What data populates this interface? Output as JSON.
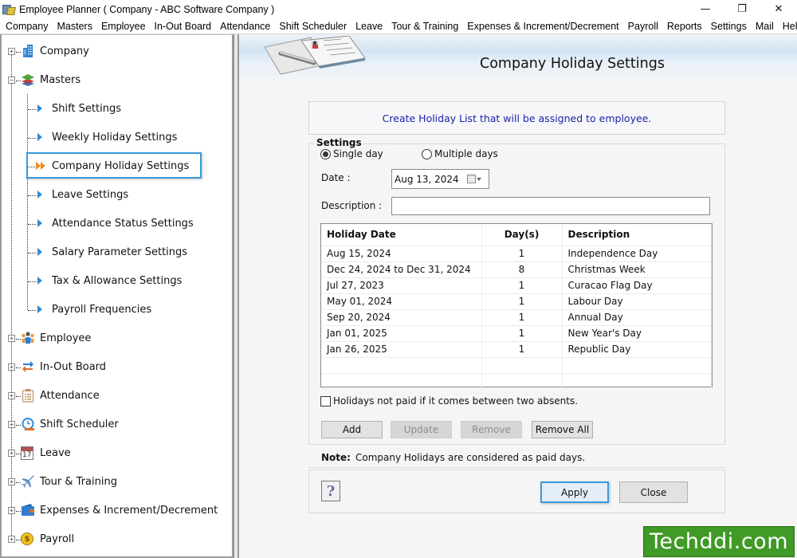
{
  "window": {
    "title": "Employee Planner ( Company - ABC Software Company )",
    "controls": {
      "minimize": "—",
      "restore": "❐",
      "close": "✕"
    }
  },
  "menu": [
    "Company",
    "Masters",
    "Employee",
    "In-Out Board",
    "Attendance",
    "Shift Scheduler",
    "Leave",
    "Tour & Training",
    "Expenses & Increment/Decrement",
    "Payroll",
    "Reports",
    "Settings",
    "Mail",
    "Help"
  ],
  "sidebar": {
    "top_nodes": [
      {
        "label": "Company",
        "icon": "building-icon",
        "expander": "+"
      },
      {
        "label": "Masters",
        "icon": "layers-icon",
        "expander": "−"
      },
      {
        "label": "Employee",
        "icon": "people-icon",
        "expander": "+"
      },
      {
        "label": "In-Out Board",
        "icon": "swap-arrows-icon",
        "expander": "+"
      },
      {
        "label": "Attendance",
        "icon": "clipboard-icon",
        "expander": "+"
      },
      {
        "label": "Shift Scheduler",
        "icon": "clock-icon",
        "expander": "+"
      },
      {
        "label": "Leave",
        "icon": "calendar-icon",
        "expander": "+",
        "badge": "17"
      },
      {
        "label": "Tour & Training",
        "icon": "airplane-icon",
        "expander": "+"
      },
      {
        "label": "Expenses & Increment/Decrement",
        "icon": "wallet-icon",
        "expander": "+"
      },
      {
        "label": "Payroll",
        "icon": "coin-icon",
        "expander": "+",
        "badge": "$"
      }
    ],
    "masters_children": [
      {
        "label": "Shift Settings",
        "selected": false
      },
      {
        "label": "Weekly Holiday Settings",
        "selected": false
      },
      {
        "label": "Company Holiday Settings",
        "selected": true
      },
      {
        "label": "Leave Settings",
        "selected": false
      },
      {
        "label": "Attendance Status Settings",
        "selected": false
      },
      {
        "label": "Salary Parameter Settings",
        "selected": false
      },
      {
        "label": "Tax & Allowance Settings",
        "selected": false
      },
      {
        "label": "Payroll Frequencies",
        "selected": false
      }
    ]
  },
  "main": {
    "page_title": "Company Holiday Settings",
    "info_text": "Create Holiday List that will be assigned to employee.",
    "settings": {
      "legend": "Settings",
      "radio_single": "Single day",
      "radio_multiple": "Multiple days",
      "selected_mode": "single",
      "date_label": "Date :",
      "date_value": "Aug 13, 2024",
      "description_label": "Description :",
      "description_value": ""
    },
    "grid": {
      "columns": [
        "Holiday Date",
        "Day(s)",
        "Description"
      ],
      "rows": [
        [
          "Aug 15, 2024",
          "1",
          "Independence Day"
        ],
        [
          "Dec 24, 2024 to Dec 31, 2024",
          "8",
          "Christmas Week"
        ],
        [
          "Jul 27, 2023",
          "1",
          "Curacao Flag Day"
        ],
        [
          "May 01, 2024",
          "1",
          "Labour Day"
        ],
        [
          "Sep 20, 2024",
          "1",
          "Annual Day"
        ],
        [
          "Jan 01, 2025",
          "1",
          "New Year's Day"
        ],
        [
          "Jan 26, 2025",
          "1",
          "Republic Day"
        ]
      ]
    },
    "checkbox_label": "Holidays not paid if it comes between two absents.",
    "checkbox_checked": false,
    "buttons": {
      "add": "Add",
      "update": "Update",
      "remove": "Remove",
      "remove_all": "Remove All",
      "apply": "Apply",
      "close": "Close",
      "help": "?"
    },
    "note_label": "Note:",
    "note_text": "Company Holidays are considered as paid days."
  },
  "watermark": "Techddi.com",
  "colors": {
    "accent_blue": "#3a9ad9",
    "info_text": "#1a22a8",
    "tree_arrow": "#2e8ad8",
    "active_arrow": "#f08a1c",
    "watermark_bg": "#3f9a26"
  }
}
